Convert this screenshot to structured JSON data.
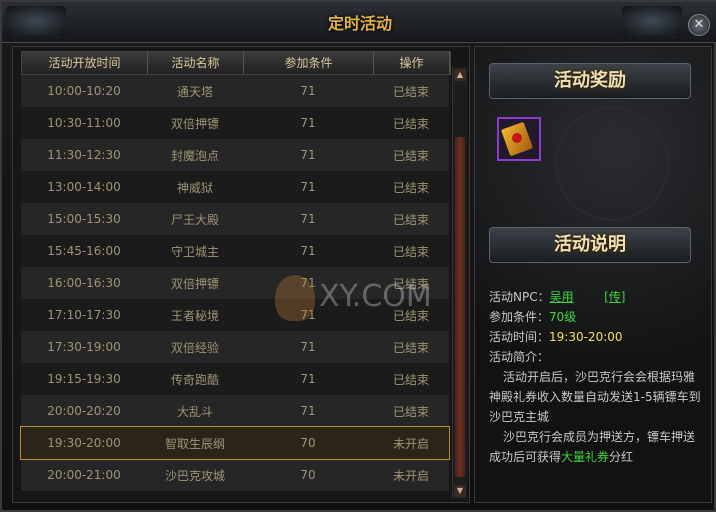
{
  "window": {
    "title": "定时活动",
    "close_label": "✕"
  },
  "table": {
    "headers": [
      "活动开放时间",
      "活动名称",
      "参加条件",
      "操作"
    ],
    "rows": [
      {
        "time": "10:00-10:20",
        "name": "通天塔",
        "condition": "71",
        "status": "已结束"
      },
      {
        "time": "10:30-11:00",
        "name": "双倍押镖",
        "condition": "71",
        "status": "已结束"
      },
      {
        "time": "11:30-12:30",
        "name": "封魔泡点",
        "condition": "71",
        "status": "已结束"
      },
      {
        "time": "13:00-14:00",
        "name": "神威狱",
        "condition": "71",
        "status": "已结束"
      },
      {
        "time": "15:00-15:30",
        "name": "尸王大殿",
        "condition": "71",
        "status": "已结束"
      },
      {
        "time": "15:45-16:00",
        "name": "守卫城主",
        "condition": "71",
        "status": "已结束"
      },
      {
        "time": "16:00-16:30",
        "name": "双倍押镖",
        "condition": "71",
        "status": "已结束"
      },
      {
        "time": "17:10-17:30",
        "name": "王者秘境",
        "condition": "71",
        "status": "已结束"
      },
      {
        "time": "17:30-19:00",
        "name": "双倍经验",
        "condition": "71",
        "status": "已结束"
      },
      {
        "time": "19:15-19:30",
        "name": "传奇跑酷",
        "condition": "71",
        "status": "已结束"
      },
      {
        "time": "20:00-20:20",
        "name": "大乱斗",
        "condition": "71",
        "status": "已结束"
      },
      {
        "time": "19:30-20:00",
        "name": "智取生辰纲",
        "condition": "70",
        "status": "未开启",
        "selected": true
      },
      {
        "time": "20:00-21:00",
        "name": "沙巴克攻城",
        "condition": "70",
        "status": "未开启"
      }
    ]
  },
  "reward": {
    "banner": "活动奖励",
    "item_icon": "scroll-item-icon"
  },
  "info": {
    "banner": "活动说明",
    "npc_label": "活动NPC：",
    "npc_name": "吴用",
    "npc_link": "[传]",
    "cond_label": "参加条件：",
    "cond_value": "70级",
    "time_label": "活动时间：",
    "time_value": "19:30-20:00",
    "intro_label": "活动简介：",
    "para1": "活动开启后，沙巴克行会会根据玛雅神殿礼券收入数量自动发送1-5辆镖车到沙巴克主城",
    "para2_a": "沙巴克行会成员为押送方，镖车押送成功后可获得",
    "para2_b": "大量礼券",
    "para2_c": "分红"
  },
  "watermark": "XY.COM",
  "colors": {
    "accent": "#e0b04a",
    "highlight": "#3fd63f",
    "time": "#f4e060"
  }
}
